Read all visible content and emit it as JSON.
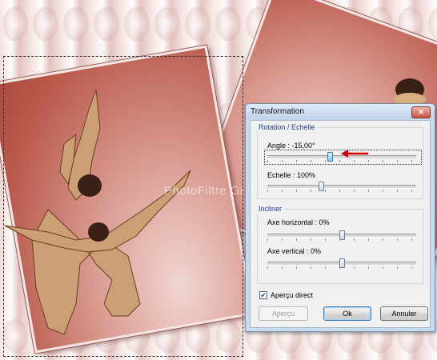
{
  "background": {
    "watermark": "PhotoFiltre Graphic"
  },
  "dialog": {
    "title": "Transformation",
    "close_label": "✕",
    "rotation_group": {
      "legend": "Rotation / Echelle",
      "angle_label": "Angle : -15,00°",
      "angle_slider_fraction": 0.42,
      "scale_label": "Echelle : 100%",
      "scale_slider_fraction": 0.36
    },
    "skew_group": {
      "legend": "Incliner",
      "horizontal_label": "Axe horizontal : 0%",
      "horizontal_slider_fraction": 0.5,
      "vertical_label": "Axe vertical : 0%",
      "vertical_slider_fraction": 0.5
    },
    "preview_checkbox": {
      "label": "Aperçu direct",
      "checked": true
    },
    "buttons": {
      "preview": "Aperçu",
      "ok": "Ok",
      "cancel": "Annuler"
    }
  },
  "colors": {
    "arrow": "#d40000",
    "accent": "#1f3f8f"
  }
}
